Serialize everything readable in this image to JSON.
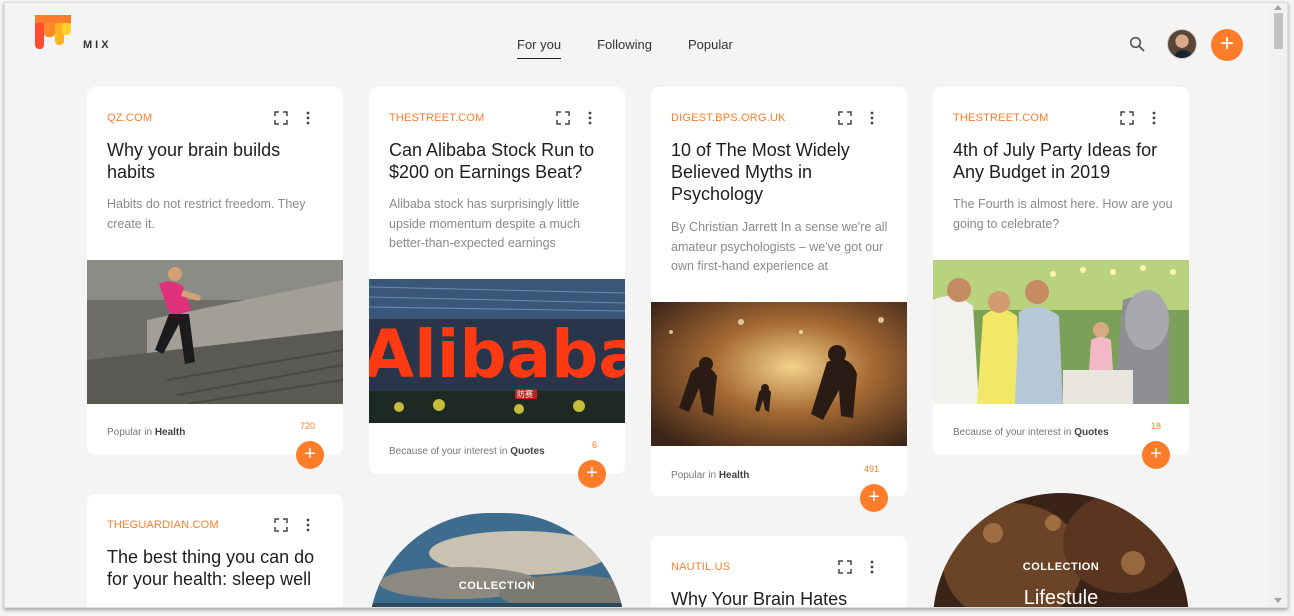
{
  "app": {
    "brand": "MIX"
  },
  "nav": {
    "items": [
      "For you",
      "Following",
      "Popular"
    ],
    "active": "For you"
  },
  "cards": [
    {
      "source": "QZ.COM",
      "title": "Why your brain builds habits",
      "desc": "Habits do not restrict freedom. They create it.",
      "why_prefix": "Popular in",
      "why_topic": "Health",
      "count": "720"
    },
    {
      "source": "THESTREET.COM",
      "title": "Can Alibaba Stock Run to $200 on Earnings Beat?",
      "desc": "Alibaba stock has surprisingly little upside momentum despite a much better-than-expected earnings",
      "why_prefix": "Because of your interest in",
      "why_topic": "Quotes",
      "count": "6",
      "image_text": "Alibaba",
      "sign_text": "防赛"
    },
    {
      "source": "DIGEST.BPS.ORG.UK",
      "title": "10 of The Most Widely Believed Myths in Psychology",
      "desc": "By Christian Jarrett In a sense we're all amateur psychologists – we've got our own first-hand experience at",
      "why_prefix": "Popular in",
      "why_topic": "Health",
      "count": "491"
    },
    {
      "source": "THESTREET.COM",
      "title": "4th of July Party Ideas for Any Budget in 2019",
      "desc": "The Fourth is almost here. How are you going to celebrate?",
      "why_prefix": "Because of your interest in",
      "why_topic": "Quotes",
      "count": "18"
    },
    {
      "source": "THEGUARDIAN.COM",
      "title": "The best thing you can do for your health: sleep well"
    },
    {
      "source": "NAUTIL.US",
      "title": "Why Your Brain Hates"
    }
  ],
  "collections": [
    {
      "label": "COLLECTION",
      "title": ""
    },
    {
      "label": "COLLECTION",
      "title": "Lifestule"
    }
  ],
  "colors": {
    "accent": "#ff7c2b",
    "background": "#f4f4f4",
    "card": "#ffffff"
  }
}
